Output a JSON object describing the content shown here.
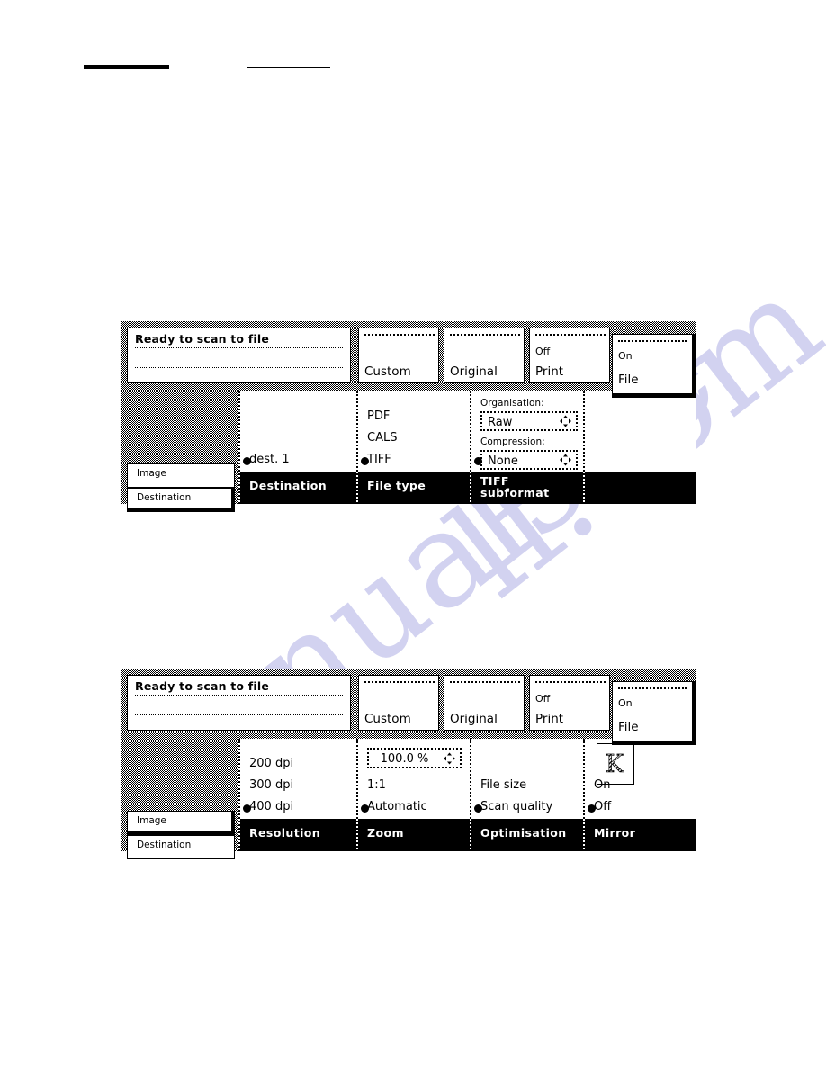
{
  "document": {
    "watermark_text_a": "nualshe",
    "watermark_text_b": "lf.com",
    "watermark_color": "#d2d2f0"
  },
  "panels": [
    {
      "name": "destination-panel",
      "header": {
        "status_title": "Ready to scan to file",
        "cells": [
          {
            "name": "media-cell",
            "sub": "",
            "main": "Custom"
          },
          {
            "name": "quality-cell",
            "sub": "",
            "main": "Original"
          },
          {
            "name": "output-cell",
            "sub": "Off",
            "main": "Print"
          }
        ],
        "raised_cell": {
          "name": "file-output-cell",
          "sub": "On",
          "main": "File"
        }
      },
      "tabs": [
        {
          "label": "Image",
          "active": false
        },
        {
          "label": "Destination",
          "active": true
        }
      ],
      "columns": [
        {
          "footer": "Destination",
          "footer_lines": [
            "Destination"
          ],
          "options": [
            {
              "label": "",
              "selected": false,
              "row": 1
            },
            {
              "label": "",
              "selected": false,
              "row": 2
            },
            {
              "label": "dest. 1",
              "selected": true,
              "row": 3
            }
          ]
        },
        {
          "footer": "File type",
          "footer_lines": [
            "File type"
          ],
          "options": [
            {
              "label": "PDF",
              "selected": false,
              "row": 1
            },
            {
              "label": "CALS",
              "selected": false,
              "row": 2
            },
            {
              "label": "TIFF",
              "selected": true,
              "row": 3
            }
          ]
        },
        {
          "footer": "TIFF subformat",
          "footer_lines": [
            "TIFF",
            "subformat"
          ],
          "fields": [
            {
              "label": "Organisation:",
              "value": "Raw"
            },
            {
              "label": "Compression:",
              "value": "None",
              "selected": true
            }
          ]
        },
        {
          "footer": "",
          "footer_lines": [
            ""
          ],
          "options": []
        }
      ]
    },
    {
      "name": "image-panel",
      "header": {
        "status_title": "Ready to scan to file",
        "cells": [
          {
            "name": "media-cell",
            "sub": "",
            "main": "Custom"
          },
          {
            "name": "quality-cell",
            "sub": "",
            "main": "Original"
          },
          {
            "name": "output-cell",
            "sub": "Off",
            "main": "Print"
          }
        ],
        "raised_cell": {
          "name": "file-output-cell",
          "sub": "On",
          "main": "File"
        }
      },
      "tabs": [
        {
          "label": "Image",
          "active": true
        },
        {
          "label": "Destination",
          "active": false
        }
      ],
      "columns": [
        {
          "footer": "Resolution",
          "footer_lines": [
            "Resolution"
          ],
          "options": [
            {
              "label": "200 dpi",
              "selected": false,
              "row": 1
            },
            {
              "label": "300 dpi",
              "selected": false,
              "row": 2
            },
            {
              "label": "400 dpi",
              "selected": true,
              "row": 3
            }
          ]
        },
        {
          "footer": "Zoom",
          "footer_lines": [
            "Zoom"
          ],
          "spinner": {
            "value": "100.0 %"
          },
          "options": [
            {
              "label": "1:1",
              "selected": false,
              "row": 2
            },
            {
              "label": "Automatic",
              "selected": true,
              "row": 3
            }
          ]
        },
        {
          "footer": "Optimisation",
          "footer_lines": [
            "Optimisation"
          ],
          "options": [
            {
              "label": "File size",
              "selected": false,
              "row": 2
            },
            {
              "label": "Scan quality",
              "selected": true,
              "row": 3
            }
          ]
        },
        {
          "footer": "Mirror",
          "footer_lines": [
            "Mirror"
          ],
          "icon": "mirror-k-icon",
          "options": [
            {
              "label": "On",
              "selected": false,
              "row": 2
            },
            {
              "label": "Off",
              "selected": true,
              "row": 3
            }
          ]
        }
      ]
    }
  ]
}
